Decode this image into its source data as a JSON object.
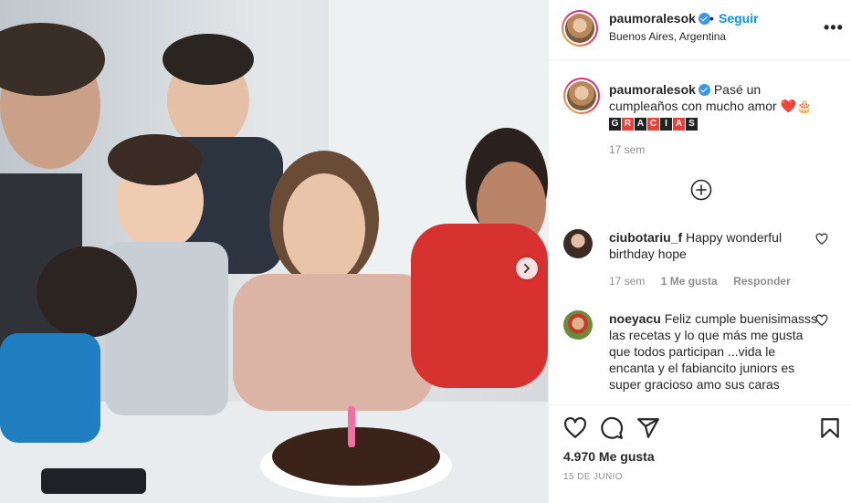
{
  "post": {
    "username": "paumoralesok",
    "separator": "•",
    "follow_label": "Seguir",
    "location": "Buenos Aires, Argentina",
    "more_label": "•••",
    "caption": {
      "username": "paumoralesok",
      "text": "Pasé un cumpleaños con mucho amor",
      "emojis": "❤️🎂",
      "gracias_letters": [
        "G",
        "R",
        "A",
        "C",
        "I",
        "A",
        "S"
      ],
      "time": "17 sem"
    },
    "load_more_icon": "plus-circle-icon",
    "comments": [
      {
        "username": "ciubotariu_f",
        "text": "Happy wonderful birthday hope",
        "time": "17 sem",
        "likes": "1 Me gusta",
        "reply": "Responder"
      },
      {
        "username": "noeyacu",
        "text": "Feliz cumple buenisimasss las recetas y lo que más me gusta que todos participan ...vida le encanta y el fabiancito juniors es super gracioso amo sus caras"
      }
    ],
    "actions": [
      "heart-icon",
      "comment-icon",
      "share-icon",
      "bookmark-icon"
    ],
    "likes_label": "4.970 Me gusta",
    "date": "15 DE JUNIO"
  },
  "colors": {
    "accent": "#0095f6",
    "verified": "#3897f0",
    "meta_gray": "#8e8e8e",
    "gracias_red": "#e8403a",
    "gracias_dark": "#222222"
  }
}
